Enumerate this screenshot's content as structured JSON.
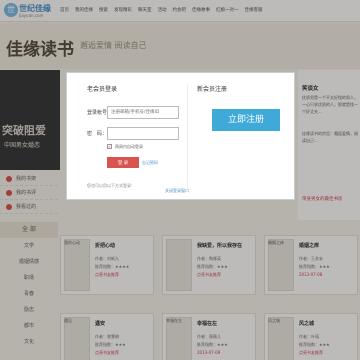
{
  "site": {
    "logo_mark": "世",
    "logo_name": "世纪佳缘",
    "logo_url": "jiayuan.com"
  },
  "nav": [
    "首页",
    "我的佳缘",
    "搜索",
    "发现精彩",
    "聊天室",
    "活动",
    "约会吧",
    "佳缘故事",
    "红娘一对一",
    "佳缘客服"
  ],
  "banner": {
    "brand": "佳缘读书",
    "slogan": "邂逅爱情  阅读自己"
  },
  "promo": {
    "line1": "突破阻爱",
    "line2": "中国男女婚恋"
  },
  "sidemenu": {
    "items": [
      "我的书架",
      "我的书评",
      "我看过的"
    ],
    "all": "全 部",
    "categories": [
      "文学",
      "婚姻情感",
      "职场",
      "青春",
      "励志",
      "都市",
      "文化"
    ]
  },
  "rpanel": {
    "heading": "笑谈女",
    "para1": "优质男是一个不太好找的男人，一心只求优质的人，那就是找一个好丈夫...",
    "para2": "佳缘读书的宗旨：邂逅爱情，阅读自己...",
    "tag": "单身男女的最佳书房"
  },
  "content": {
    "cards": [
      {
        "name": "我的心动",
        "title": "折把心动",
        "l1": "作者：刘新九",
        "l2": "推荐指数：★★★★",
        "l3": "点亮书友推荐"
      },
      {
        "name": "我的心动",
        "title": "我缺爱，所以我存在",
        "l1": "作者：陶娜英",
        "l2": "推荐指数：★★★",
        "l3": "点亮书友推荐"
      },
      {
        "name": "婚姻之痒",
        "title": "婚姻之痒",
        "l1": "作者：王苏安",
        "l2": "推荐指数：★★★",
        "l3": "2013-07-08"
      },
      {
        "name": "遇见",
        "title": "遇安",
        "l1": "作者：曾慧琳",
        "l2": "推荐指数：★★★",
        "l3": "点亮书友推荐"
      },
      {
        "name": "幸福在左",
        "title": "幸福在左",
        "l1": "作者：薇薇儿",
        "l2": "推荐指数：★★★",
        "l3": "2013-07-09"
      },
      {
        "name": "风之城",
        "title": "风之城",
        "l1": "作者：叶璃",
        "l2": "推荐指数：★★★",
        "l3": "点亮书友推荐"
      }
    ]
  },
  "modal": {
    "login_title": "老会员登录",
    "register_title": "新会员注册",
    "account_label": "登录帐号：",
    "account_placeholder": "注册邮箱/手机号/佳缘ID",
    "password_label": "密　码：",
    "password_placeholder": "",
    "remember_label": "两周内自动登录",
    "login_button": "登 录",
    "forgot_link": "忘记密码",
    "other_login": "您也可以用以下方式登录：",
    "register_button": "立即注册",
    "close_link": "关闭登录窗口"
  },
  "colors": {
    "accent_blue": "#3fa9d8",
    "accent_red": "#d9534f"
  }
}
